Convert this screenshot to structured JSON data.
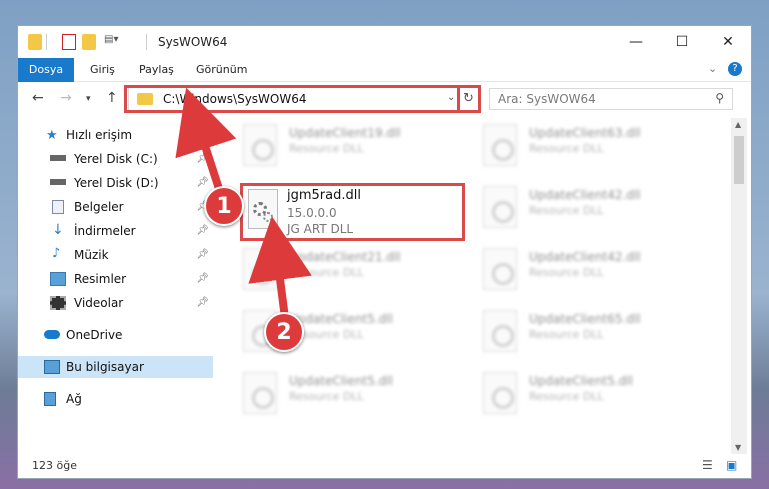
{
  "window": {
    "title": "SysWOW64",
    "quick_access_icons": [
      "folder-icon",
      "properties-icon",
      "new-folder-icon",
      "customize-icon"
    ]
  },
  "ribbon": {
    "tabs": [
      {
        "label": "Dosya"
      },
      {
        "label": "Giriş"
      },
      {
        "label": "Paylaş"
      },
      {
        "label": "Görünüm"
      }
    ]
  },
  "address": {
    "path": "C:\\Windows\\SysWOW64",
    "search_placeholder": "Ara: SysWOW64"
  },
  "nav": {
    "quick_access": "Hızlı erişim",
    "items": [
      {
        "label": "Yerel Disk (C:)",
        "icon": "drive-icon"
      },
      {
        "label": "Yerel Disk (D:)",
        "icon": "drive-icon"
      },
      {
        "label": "Belgeler",
        "icon": "documents-icon"
      },
      {
        "label": "İndirmeler",
        "icon": "download-icon"
      },
      {
        "label": "Müzik",
        "icon": "music-icon"
      },
      {
        "label": "Resimler",
        "icon": "pictures-icon"
      },
      {
        "label": "Videolar",
        "icon": "videos-icon"
      }
    ],
    "onedrive": "OneDrive",
    "this_pc": "Bu bilgisayar",
    "network": "Ağ"
  },
  "files_background": [
    {
      "name": "UpdateClient19.dll",
      "desc": "Resource DLL"
    },
    {
      "name": "UpdateClient63.dll",
      "desc": "Resource DLL"
    },
    {
      "name": "UpdateClient42.dll",
      "desc": "Resource DLL"
    },
    {
      "name": "UpdateClient21.dll",
      "desc": "Resource DLL"
    },
    {
      "name": "UpdateClient42.dll",
      "desc": "Resource DLL"
    },
    {
      "name": "UpdateClient5.dll",
      "desc": "Resource DLL"
    },
    {
      "name": "UpdateClient65.dll",
      "desc": "Resource DLL"
    },
    {
      "name": "UpdateClient5.dll",
      "desc": "Resource DLL"
    },
    {
      "name": "UpdateClient5.dll",
      "desc": "Resource DLL"
    }
  ],
  "highlighted_file": {
    "name": "jgm5rad.dll",
    "version": "15.0.0.0",
    "description": "JG ART DLL"
  },
  "status": {
    "item_count": "123 öğe"
  },
  "annotations": {
    "step1": "1",
    "step2": "2",
    "color": "#dd3b3b"
  }
}
